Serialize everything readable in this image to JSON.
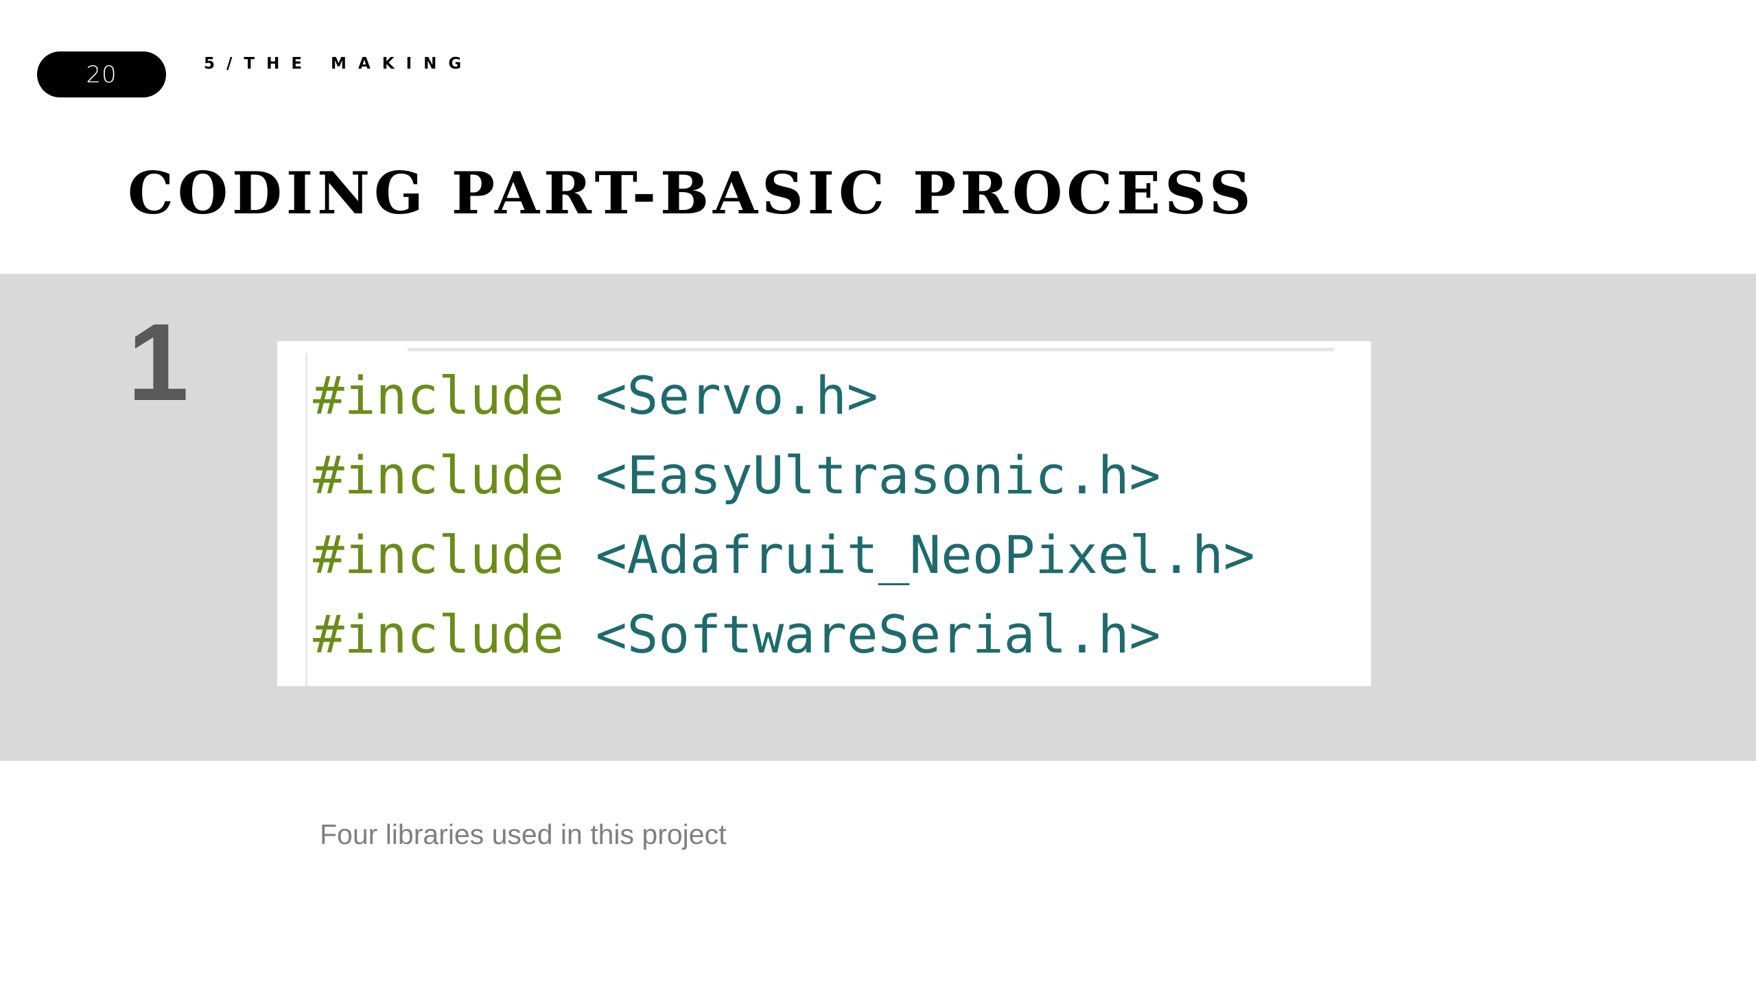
{
  "header": {
    "page_number": "20",
    "section": "5/THE MAKING"
  },
  "title": "CODING PART-BASIC PROCESS",
  "step": {
    "number": "1"
  },
  "code": {
    "directive": "#include",
    "lines": [
      "<Servo.h>",
      "<EasyUltrasonic.h>",
      "<Adafruit_NeoPixel.h>",
      "<SoftwareSerial.h>"
    ]
  },
  "caption": "Four libraries used in this project",
  "colors": {
    "band": "#d9d9d9",
    "directive": "#6a8c1a",
    "header_name": "#1f6a6c",
    "caption": "#7f7f7f",
    "step_number": "#595959"
  }
}
